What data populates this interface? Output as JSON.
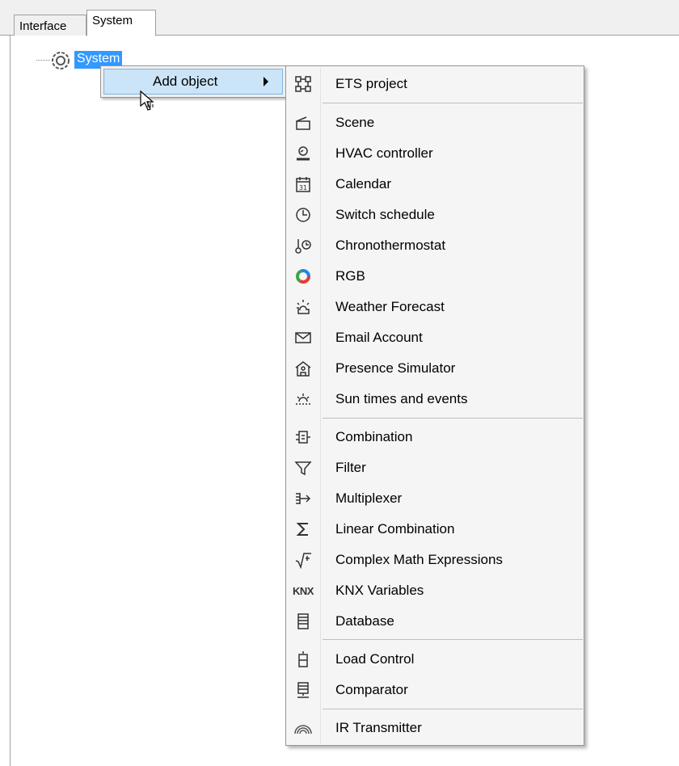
{
  "tabs": {
    "interface": "Interface",
    "system": "System"
  },
  "tree": {
    "root_label": "System"
  },
  "context_menu": {
    "add_object": "Add object"
  },
  "submenu": {
    "items": [
      {
        "label": "ETS project",
        "icon": "ets-project-icon"
      },
      {
        "label": "Scene",
        "icon": "scene-icon"
      },
      {
        "label": "HVAC controller",
        "icon": "hvac-controller-icon"
      },
      {
        "label": "Calendar",
        "icon": "calendar-icon"
      },
      {
        "label": "Switch schedule",
        "icon": "clock-icon"
      },
      {
        "label": "Chronothermostat",
        "icon": "chronothermostat-icon"
      },
      {
        "label": "RGB",
        "icon": "rgb-color-wheel-icon"
      },
      {
        "label": "Weather Forecast",
        "icon": "weather-sun-cloud-icon"
      },
      {
        "label": "Email Account",
        "icon": "email-envelope-icon"
      },
      {
        "label": "Presence Simulator",
        "icon": "house-icon"
      },
      {
        "label": "Sun times and events",
        "icon": "sunrise-icon"
      },
      {
        "label": "Combination",
        "icon": "combination-icon"
      },
      {
        "label": "Filter",
        "icon": "filter-funnel-icon"
      },
      {
        "label": "Multiplexer",
        "icon": "multiplexer-icon"
      },
      {
        "label": "Linear Combination",
        "icon": "sigma-icon"
      },
      {
        "label": "Complex Math Expressions",
        "icon": "square-root-icon"
      },
      {
        "label": "KNX Variables",
        "icon": "knx-icon",
        "icon_text": "KNX"
      },
      {
        "label": "Database",
        "icon": "database-icon"
      },
      {
        "label": "Load Control",
        "icon": "load-control-icon"
      },
      {
        "label": "Comparator",
        "icon": "comparator-icon"
      },
      {
        "label": "IR Transmitter",
        "icon": "ir-transmitter-icon"
      }
    ]
  }
}
